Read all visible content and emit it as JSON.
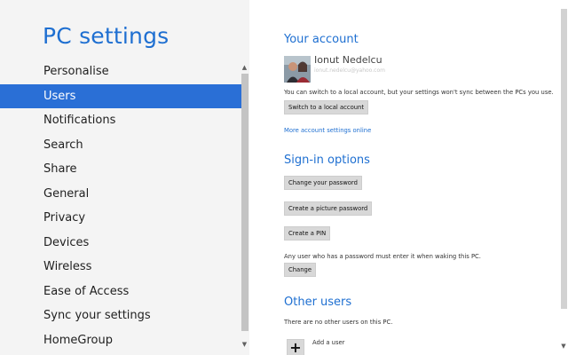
{
  "app": {
    "title": "PC settings"
  },
  "nav": {
    "items": [
      {
        "label": "Personalise",
        "selected": false
      },
      {
        "label": "Users",
        "selected": true
      },
      {
        "label": "Notifications",
        "selected": false
      },
      {
        "label": "Search",
        "selected": false
      },
      {
        "label": "Share",
        "selected": false
      },
      {
        "label": "General",
        "selected": false
      },
      {
        "label": "Privacy",
        "selected": false
      },
      {
        "label": "Devices",
        "selected": false
      },
      {
        "label": "Wireless",
        "selected": false
      },
      {
        "label": "Ease of Access",
        "selected": false
      },
      {
        "label": "Sync your settings",
        "selected": false
      },
      {
        "label": "HomeGroup",
        "selected": false
      }
    ]
  },
  "account": {
    "heading": "Your account",
    "user_name": "Ionut Nedelcu",
    "user_email": "ionut.nedelcu@yahoo.com",
    "local_notice": "You can switch to a local account, but your settings won't sync between the PCs you use.",
    "switch_button": "Switch to a local account",
    "more_link": "More account settings online"
  },
  "signin": {
    "heading": "Sign-in options",
    "change_password_button": "Change your password",
    "picture_password_button": "Create a picture password",
    "pin_button": "Create a PIN",
    "wake_notice": "Any user who has a password must enter it when waking this PC.",
    "change_button": "Change"
  },
  "other_users": {
    "heading": "Other users",
    "notice": "There are no other users on this PC.",
    "add_label": "Add a user"
  },
  "icons": {
    "scroll_up": "triangle-up-icon",
    "scroll_down": "triangle-down-icon",
    "add": "plus-icon"
  },
  "colors": {
    "accent": "#1e6fd1",
    "selected_bg": "#2a6fd6",
    "left_pane_bg": "#f4f4f4",
    "button_bg": "#d8d8d8"
  }
}
